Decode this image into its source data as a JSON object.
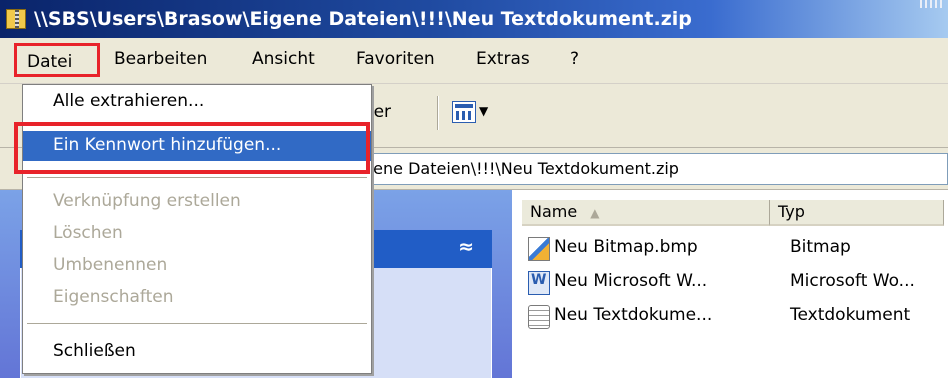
{
  "window": {
    "title": "\\\\SBS\\Users\\Brasow\\Eigene Dateien\\!!!\\Neu Textdokument.zip"
  },
  "menubar": {
    "items": [
      "Datei",
      "Bearbeiten",
      "Ansicht",
      "Favoriten",
      "Extras",
      "?"
    ]
  },
  "toolbar": {
    "partial_label": "dner"
  },
  "address": {
    "visible_text": "gene Dateien\\!!!\\Neu Textdokument.zip"
  },
  "file_menu": {
    "items": [
      {
        "label": "Alle extrahieren...",
        "state": "enabled"
      },
      {
        "label": "Ein Kennwort hinzufügen...",
        "state": "highlighted"
      },
      {
        "label": "Verknüpfung erstellen",
        "state": "disabled"
      },
      {
        "label": "Löschen",
        "state": "disabled"
      },
      {
        "label": "Umbenennen",
        "state": "disabled"
      },
      {
        "label": "Eigenschaften",
        "state": "disabled"
      },
      {
        "label": "Schließen",
        "state": "enabled"
      }
    ]
  },
  "filelist": {
    "columns": [
      "Name",
      "Typ"
    ],
    "sort_indicator": "▲",
    "rows": [
      {
        "name": "Neu Bitmap.bmp",
        "type": "Bitmap",
        "icon": "bitmap-file-icon"
      },
      {
        "name": "Neu Microsoft W...",
        "type": "Microsoft Wo...",
        "icon": "word-document-icon"
      },
      {
        "name": "Neu Textdokume...",
        "type": "Textdokument",
        "icon": "text-file-icon"
      }
    ]
  },
  "taskpane": {
    "collapse_glyph": "≈"
  },
  "colors": {
    "titlebar_dark": "#0a246a",
    "menu_highlight": "#316ac5",
    "annotation_red": "#e8232a",
    "disabled_text": "#aca899",
    "taskpane_blue": "#6375d6"
  }
}
